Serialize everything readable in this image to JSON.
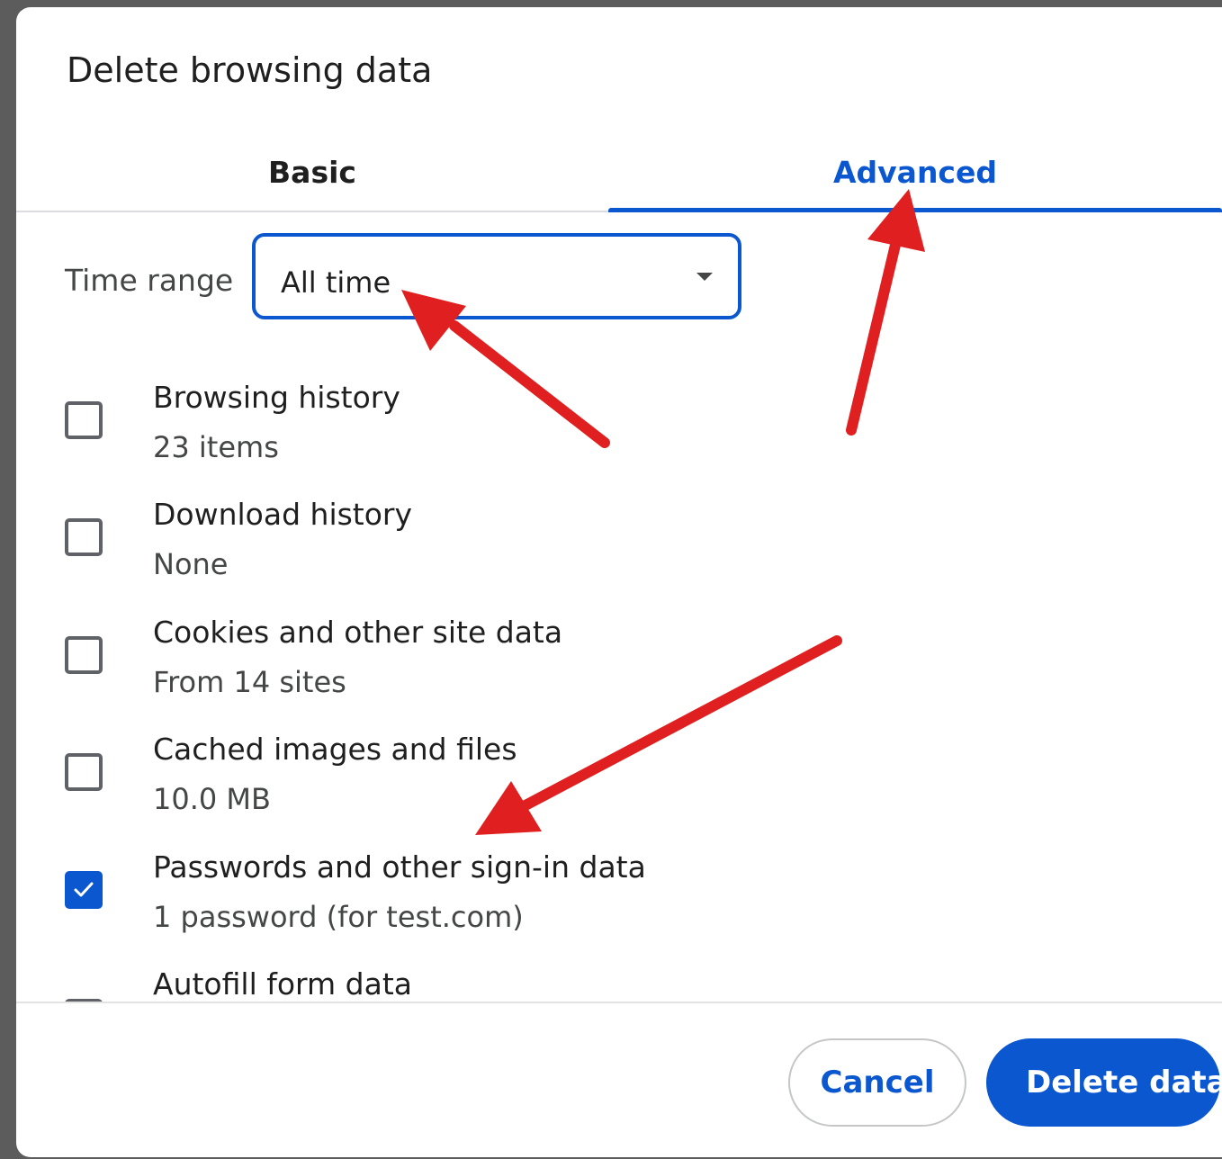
{
  "dialog": {
    "title": "Delete browsing data",
    "tabs": [
      {
        "label": "Basic",
        "active": false
      },
      {
        "label": "Advanced",
        "active": true
      }
    ],
    "time_range": {
      "label": "Time range",
      "value": "All time"
    },
    "items": [
      {
        "label": "Browsing history",
        "detail": "23 items",
        "checked": false
      },
      {
        "label": "Download history",
        "detail": "None",
        "checked": false
      },
      {
        "label": "Cookies and other site data",
        "detail": "From 14 sites",
        "checked": false
      },
      {
        "label": "Cached images and files",
        "detail": "10.0 MB",
        "checked": false
      },
      {
        "label": "Passwords and other sign-in data",
        "detail": "1 password (for test.com)",
        "checked": true
      },
      {
        "label": "Autofill form data",
        "detail": "",
        "checked": false
      }
    ],
    "buttons": {
      "cancel": "Cancel",
      "delete": "Delete data"
    }
  },
  "colors": {
    "accent": "#0b57d0",
    "annotation_arrow": "#e02020"
  },
  "icons": {
    "dropdown": "caret-down-icon",
    "check": "checkmark-icon"
  }
}
